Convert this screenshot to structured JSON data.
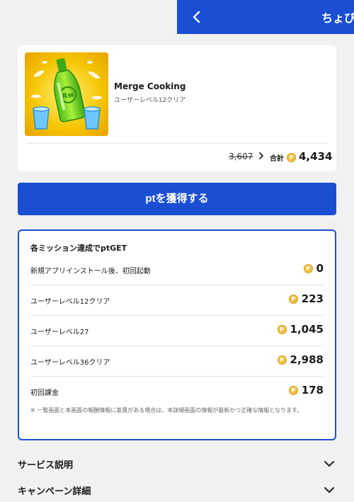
{
  "header": {
    "title": "ちょびリッチ",
    "back_icon": "chevron-left-icon"
  },
  "app": {
    "name": "Merge Cooking",
    "subtitle": "ユーザーレベル12クリア",
    "old_points": "3,607",
    "total_label": "合計",
    "total_points": "4,434",
    "coin_symbol": "P"
  },
  "cta": {
    "label": "ptを獲得する"
  },
  "missions": {
    "title": "各ミッション達成でptGET",
    "items": [
      {
        "label": "新規アプリインストール後、初回起動",
        "points": "0"
      },
      {
        "label": "ユーザーレベル12クリア",
        "points": "223"
      },
      {
        "label": "ユーザーレベル27",
        "points": "1,045"
      },
      {
        "label": "ユーザーレベル36クリア",
        "points": "2,988"
      },
      {
        "label": "初回課金",
        "points": "178"
      }
    ],
    "note": "※ 一覧画面と本画面の報酬情報に差異がある場合は、本詳細画面の情報が最新かつ正確な情報となります。"
  },
  "sections": [
    {
      "label": "サービス説明"
    },
    {
      "label": "キャンペーン詳細"
    }
  ],
  "colors": {
    "brand": "#1a4fd4",
    "coin": "#f0bf3a",
    "background": "#f1f1f1"
  }
}
